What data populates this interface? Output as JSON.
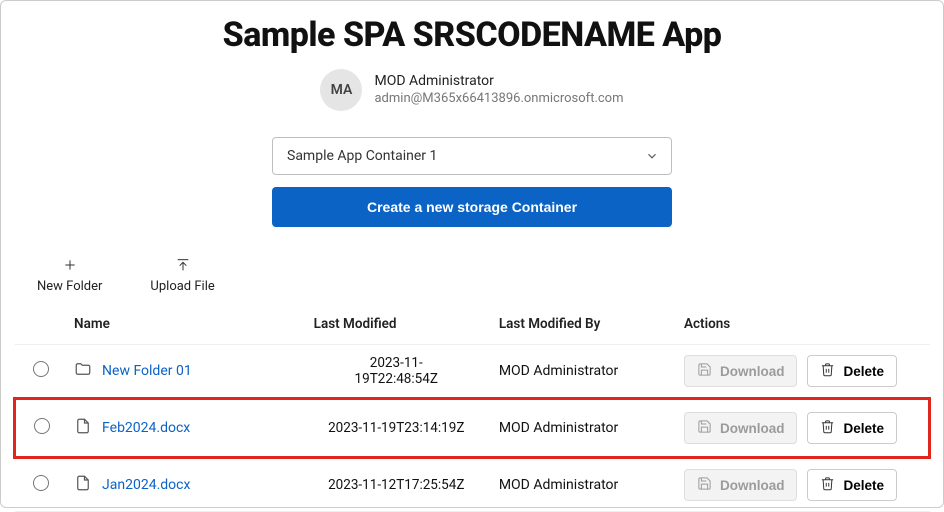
{
  "header": {
    "title": "Sample SPA SRSCODENAME App",
    "avatar_initials": "MA",
    "user_name": "MOD Administrator",
    "user_email": "admin@M365x66413896.onmicrosoft.com"
  },
  "controls": {
    "container_selected": "Sample App Container 1",
    "create_button": "Create a new storage Container"
  },
  "toolbar": {
    "new_folder": "New Folder",
    "upload_file": "Upload File"
  },
  "columns": {
    "name": "Name",
    "modified": "Last Modified",
    "modified_by": "Last Modified By",
    "actions": "Actions"
  },
  "action_labels": {
    "download": "Download",
    "delete": "Delete"
  },
  "rows": [
    {
      "type": "folder",
      "name": "New Folder 01",
      "modified": "2023-11-19T22:48:54Z",
      "modified_wrap": true,
      "modified_by": "MOD Administrator",
      "download_disabled": true,
      "highlight": false
    },
    {
      "type": "file",
      "name": "Feb2024.docx",
      "modified": "2023-11-19T23:14:19Z",
      "modified_wrap": false,
      "modified_by": "MOD Administrator",
      "download_disabled": true,
      "highlight": true
    },
    {
      "type": "file",
      "name": "Jan2024.docx",
      "modified": "2023-11-12T17:25:54Z",
      "modified_wrap": false,
      "modified_by": "MOD Administrator",
      "download_disabled": true,
      "highlight": false
    }
  ]
}
